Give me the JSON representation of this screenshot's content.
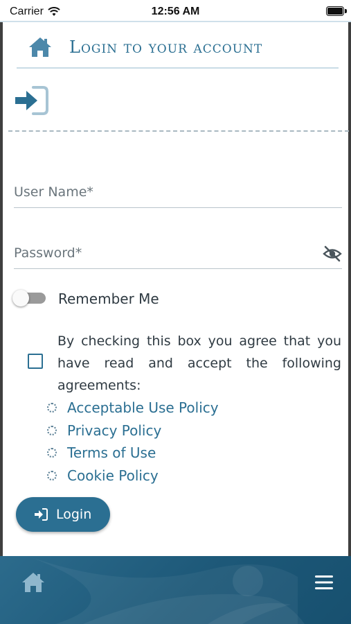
{
  "status_bar": {
    "carrier": "Carrier",
    "time": "12:56 AM"
  },
  "header": {
    "title": "Login to your account",
    "home_icon": "home-icon"
  },
  "form": {
    "username_placeholder": "User Name*",
    "password_placeholder": "Password*",
    "password_visibility_icon": "eye-slash-icon",
    "remember_label": "Remember Me",
    "remember_checked": false,
    "agreement_text": "By checking this box you agree that you have read and accept the following agreements:",
    "agreement_checked": false,
    "policies": [
      {
        "label": "Acceptable Use Policy"
      },
      {
        "label": "Privacy Policy"
      },
      {
        "label": "Terms of Use"
      },
      {
        "label": "Cookie Policy"
      }
    ],
    "login_label": "Login"
  },
  "bottom_nav": {
    "home_icon": "home-icon",
    "menu_icon": "hamburger-menu-icon"
  },
  "colors": {
    "accent": "#2b6f92",
    "bottom_bar": "#1d5878",
    "text": "#2f3a42"
  }
}
